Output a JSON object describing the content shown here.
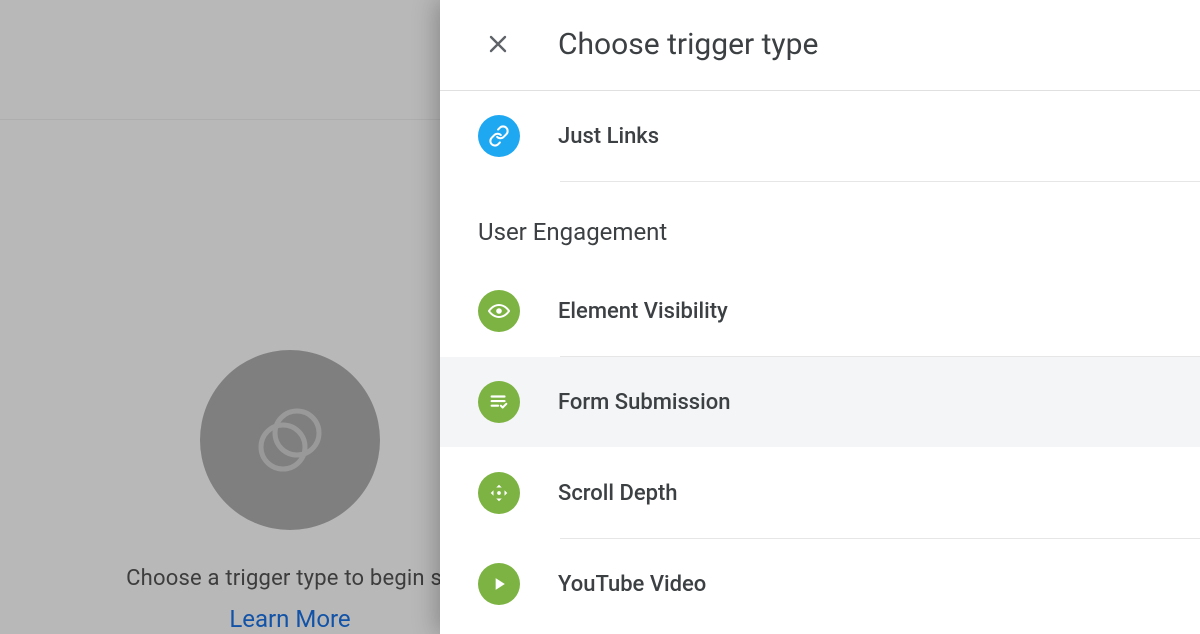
{
  "background": {
    "empty_text": "Choose a trigger type to begin se",
    "learn_more": "Learn More"
  },
  "panel": {
    "title": "Choose trigger type",
    "sections": {
      "top_item": {
        "label": "Just Links",
        "icon": "link-icon",
        "color": "blue"
      },
      "engagement_title": "User Engagement",
      "items": [
        {
          "label": "Element Visibility",
          "icon": "eye-icon",
          "color": "green"
        },
        {
          "label": "Form Submission",
          "icon": "form-icon",
          "color": "green",
          "hovered": true
        },
        {
          "label": "Scroll Depth",
          "icon": "scroll-icon",
          "color": "green"
        },
        {
          "label": "YouTube Video",
          "icon": "play-icon",
          "color": "green"
        }
      ]
    }
  },
  "colors": {
    "blue": "#1fa8f2",
    "green": "#7cb342",
    "link": "#1a73e8"
  }
}
